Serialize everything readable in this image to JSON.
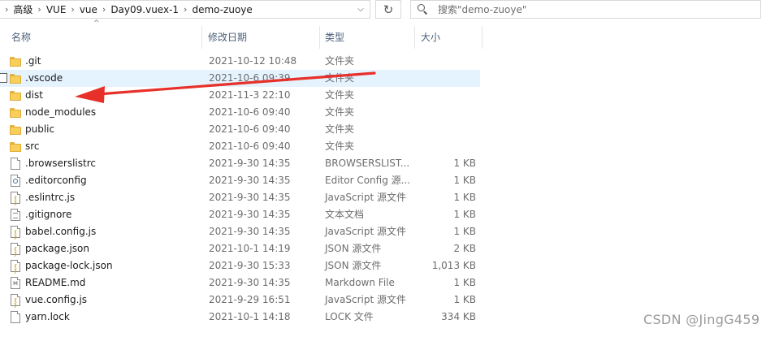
{
  "address": {
    "crumbs": [
      "高级",
      "VUE",
      "vue",
      "Day09.vuex-1",
      "demo-zuoye"
    ],
    "separator": "›",
    "dropdown": "⌵",
    "refresh_glyph": "↻"
  },
  "search": {
    "placeholder": "搜索\"demo-zuoye\""
  },
  "columns": {
    "name": "名称",
    "date": "修改日期",
    "type": "类型",
    "size": "大小",
    "sort_indicator": "^"
  },
  "files": [
    {
      "name": ".git",
      "date": "2021-10-12 10:48",
      "type": "文件夹",
      "size": "",
      "icon": "folder-icon"
    },
    {
      "name": ".vscode",
      "date": "2021-10-6 09:39",
      "type": "文件夹",
      "size": "",
      "icon": "folder-icon",
      "selected": true
    },
    {
      "name": "dist",
      "date": "2021-11-3 22:10",
      "type": "文件夹",
      "size": "",
      "icon": "folder-icon"
    },
    {
      "name": "node_modules",
      "date": "2021-10-6 09:40",
      "type": "文件夹",
      "size": "",
      "icon": "folder-icon"
    },
    {
      "name": "public",
      "date": "2021-10-6 09:40",
      "type": "文件夹",
      "size": "",
      "icon": "folder-icon"
    },
    {
      "name": "src",
      "date": "2021-10-6 09:40",
      "type": "文件夹",
      "size": "",
      "icon": "folder-icon"
    },
    {
      "name": ".browserslistrc",
      "date": "2021-9-30 14:35",
      "type": "BROWSERSLIST...",
      "size": "1 KB",
      "icon": "file-icon"
    },
    {
      "name": ".editorconfig",
      "date": "2021-9-30 14:35",
      "type": "Editor Config 源...",
      "size": "1 KB",
      "icon": "config-file-icon"
    },
    {
      "name": ".eslintrc.js",
      "date": "2021-9-30 14:35",
      "type": "JavaScript 源文件",
      "size": "1 KB",
      "icon": "js-file-icon"
    },
    {
      "name": ".gitignore",
      "date": "2021-9-30 14:35",
      "type": "文本文档",
      "size": "1 KB",
      "icon": "text-file-icon"
    },
    {
      "name": "babel.config.js",
      "date": "2021-9-30 14:35",
      "type": "JavaScript 源文件",
      "size": "1 KB",
      "icon": "js-file-icon"
    },
    {
      "name": "package.json",
      "date": "2021-10-1 14:19",
      "type": "JSON 源文件",
      "size": "2 KB",
      "icon": "json-file-icon"
    },
    {
      "name": "package-lock.json",
      "date": "2021-9-30 15:33",
      "type": "JSON 源文件",
      "size": "1,013 KB",
      "icon": "json-file-icon"
    },
    {
      "name": "README.md",
      "date": "2021-9-30 14:35",
      "type": "Markdown File",
      "size": "1 KB",
      "icon": "markdown-file-icon"
    },
    {
      "name": "vue.config.js",
      "date": "2021-9-29 16:51",
      "type": "JavaScript 源文件",
      "size": "1 KB",
      "icon": "js-file-icon"
    },
    {
      "name": "yarn.lock",
      "date": "2021-10-1 14:18",
      "type": "LOCK 文件",
      "size": "334 KB",
      "icon": "file-icon"
    }
  ],
  "watermark": "CSDN @JingG459",
  "colors": {
    "selection": "#e5f3ff",
    "arrow": "#e8302a",
    "folder": "#f8cf5b",
    "header_text": "#4c607a"
  }
}
